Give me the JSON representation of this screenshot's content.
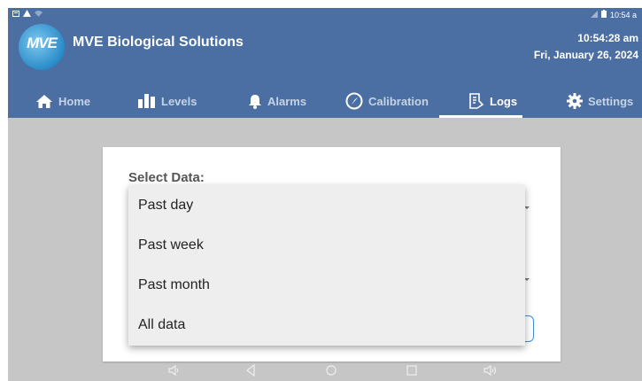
{
  "app": {
    "title": "MVE Biological Solutions",
    "logo_text": "MVE"
  },
  "status_bar": {
    "time": "10:54 a"
  },
  "clock": {
    "time": "10:54:28 am",
    "date": "Fri, January 26, 2024"
  },
  "nav": {
    "tabs": [
      {
        "label": "Home",
        "icon": "home-icon"
      },
      {
        "label": "Levels",
        "icon": "bar-chart-icon"
      },
      {
        "label": "Alarms",
        "icon": "bell-icon"
      },
      {
        "label": "Calibration",
        "icon": "compass-icon"
      },
      {
        "label": "Logs",
        "icon": "logs-icon"
      },
      {
        "label": "Settings",
        "icon": "gear-icon"
      }
    ],
    "active_tab": "Logs"
  },
  "card": {
    "select_label": "Select Data:"
  },
  "dropdown": {
    "options": [
      "Past day",
      "Past week",
      "Past month",
      "All data"
    ]
  },
  "colors": {
    "header": "#4b6fa3",
    "background": "#c6c6c6",
    "accent": "#3a8fe0"
  }
}
